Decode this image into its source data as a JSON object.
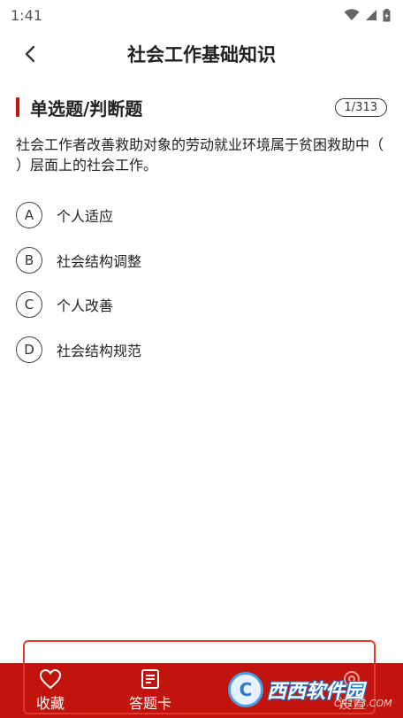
{
  "status_bar": {
    "time": "1:41"
  },
  "header": {
    "title": "社会工作基础知识"
  },
  "question_block": {
    "type_label": "单选题/判断题",
    "counter": "1/313",
    "text": "社会工作者改善救助对象的劳动就业环境属于贫困救助中（ ）层面上的社会工作。"
  },
  "options": [
    {
      "letter": "A",
      "text": "个人适应"
    },
    {
      "letter": "B",
      "text": "社会结构调整"
    },
    {
      "letter": "C",
      "text": "个人改善"
    },
    {
      "letter": "D",
      "text": "社会结构规范"
    }
  ],
  "bottom_bar": {
    "favorite_label": "收藏",
    "answer_card_label": "答题卡",
    "settings_label": "设置"
  },
  "watermark": {
    "brand": "西西软件园",
    "sub": "CR173.COM"
  },
  "colors": {
    "accent": "#c0140c",
    "highlight": "#e23a2a"
  }
}
